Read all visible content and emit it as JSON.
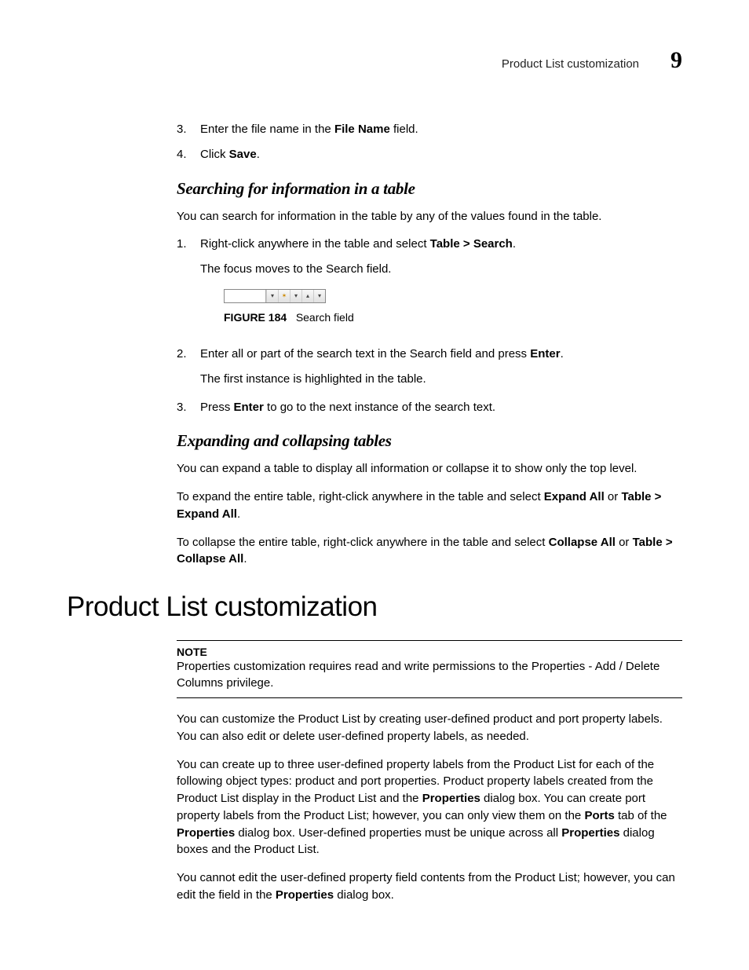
{
  "header": {
    "title": "Product List customization",
    "chapter": "9"
  },
  "steps_a": [
    {
      "num": "3.",
      "pre": "Enter the file name in the ",
      "bold": "File Name",
      "post": " field."
    },
    {
      "num": "4.",
      "pre": "Click ",
      "bold": "Save",
      "post": "."
    }
  ],
  "section_search": {
    "heading": "Searching for information in a table",
    "intro": "You can search for information in the table by any of the values found in the table.",
    "step1": {
      "num": "1.",
      "pre": "Right-click anywhere in the table and select ",
      "bold": "Table > Search",
      "post": ".",
      "sub": "The focus moves to the Search field."
    },
    "figure": {
      "num": "FIGURE 184",
      "caption": "Search field"
    },
    "step2": {
      "num": "2.",
      "pre": "Enter all or part of the search text in the Search field and press ",
      "bold": "Enter",
      "post": ".",
      "sub": "The first instance is highlighted in the table."
    },
    "step3": {
      "num": "3.",
      "pre": "Press ",
      "bold": "Enter",
      "post": " to go to the next instance of the search text."
    }
  },
  "section_expand": {
    "heading": "Expanding and collapsing tables",
    "p1": "You can expand a table to display all information or collapse it to show only the top level.",
    "p2": {
      "pre": "To expand the entire table, right-click anywhere in the table and select ",
      "b1": "Expand All",
      "mid": " or ",
      "b2": "Table > Expand All",
      "post": "."
    },
    "p3": {
      "pre": "To collapse the entire table, right-click anywhere in the table and select ",
      "b1": "Collapse All",
      "mid": " or ",
      "b2": "Table > Collapse All",
      "post": "."
    }
  },
  "major_heading": "Product List customization",
  "note": {
    "label": "NOTE",
    "text": "Properties customization requires read and write permissions to the Properties - Add / Delete Columns privilege."
  },
  "body": {
    "p1": "You can customize the Product List by creating user-defined product and port property labels. You can also edit or delete user-defined property labels, as needed.",
    "p2": {
      "t1": "You can create up to three user-defined property labels from the Product List for each of the following object types: product and port properties. Product  property labels created from the Product List display in the Product List and the ",
      "b1": "Properties",
      "t2": " dialog box. You can create port property labels from the Product List; however, you can only view them on the ",
      "b2": "Ports",
      "t3": " tab of the ",
      "b3": "Properties",
      "t4": " dialog box. User-defined properties must be unique across all ",
      "b4": "Properties",
      "t5": " dialog boxes and the Product List."
    },
    "p3": {
      "t1": "You cannot edit the user-defined property field contents from the Product List; however, you can edit the field in the ",
      "b1": "Properties",
      "t2": " dialog box."
    }
  }
}
